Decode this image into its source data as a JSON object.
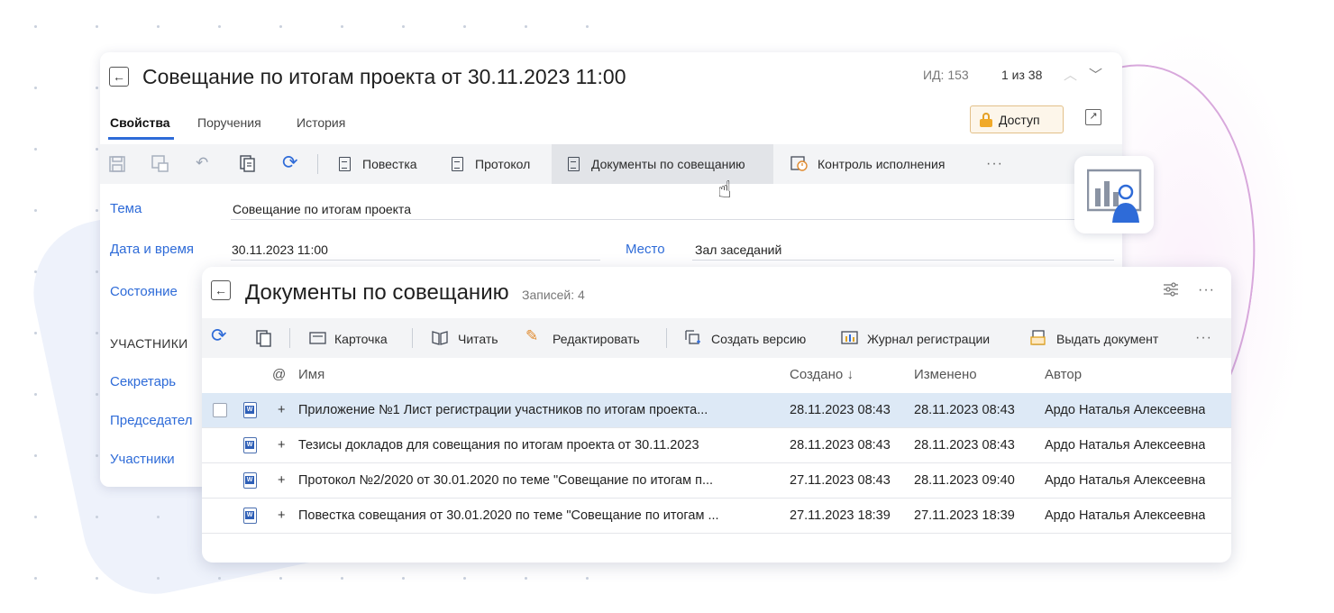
{
  "card": {
    "title": "Совещание по итогам проекта от 30.11.2023  11:00",
    "id_text": "ИД: 153",
    "nav_text": "1 из 38",
    "tabs": [
      "Свойства",
      "Поручения",
      "История"
    ],
    "access_label": "Доступ",
    "toolbar": {
      "agenda": "Повестка",
      "protocol": "Протокол",
      "documents": "Документы по совещанию",
      "control": "Контроль исполнения",
      "more": "···"
    },
    "fields": {
      "topic_label": "Тема",
      "topic_value": "Совещание по итогам проекта",
      "datetime_label": "Дата и время",
      "datetime_value": "30.11.2023  11:00",
      "place_label": "Место",
      "place_value": "Зал заседаний",
      "state_label": "Состояние",
      "participants_section": "УЧАСТНИКИ",
      "secretary_label": "Секретарь",
      "chairman_label": "Председател",
      "participants_label": "Участники"
    }
  },
  "documents": {
    "title": "Документы по совещанию",
    "count": "Записей: 4",
    "more": "···",
    "toolbar": {
      "card": "Карточка",
      "read": "Читать",
      "edit": "Редактировать",
      "new_version": "Создать версию",
      "journal": "Журнал регистрации",
      "issue": "Выдать документ",
      "more": "···"
    },
    "columns": {
      "at": "@",
      "name": "Имя",
      "created": "Создано ↓",
      "modified": "Изменено",
      "author": "Автор"
    },
    "rows": [
      {
        "plus": "+",
        "name": "Приложение №1 Лист регистрации участников по итогам проекта...",
        "created": "28.11.2023 08:43",
        "modified": "28.11.2023 08:43",
        "author": "Ардо Наталья Алексеевна"
      },
      {
        "plus": "+",
        "name": "Тезисы докладов для совещания по итогам проекта от 30.11.2023",
        "created": "28.11.2023 08:43",
        "modified": "28.11.2023 08:43",
        "author": "Ардо Наталья Алексеевна"
      },
      {
        "plus": "+",
        "name": "Протокол №2/2020 от 30.01.2020 по теме \"Совещание по итогам п...",
        "created": "27.11.2023 08:43",
        "modified": "28.11.2023 09:40",
        "author": "Ардо Наталья Алексеевна"
      },
      {
        "plus": "+",
        "name": "Повестка совещания от 30.01.2020 по теме \"Совещание по итогам ...",
        "created": "27.11.2023 18:39",
        "modified": "27.11.2023 18:39",
        "author": "Ардо Наталья Алексеевна"
      }
    ]
  },
  "icons": {
    "word": "W"
  },
  "colors": {
    "accent": "#2e6bd8",
    "selected_row": "#dde9f6",
    "access_bg": "#fdf6ea",
    "lock": "#f0a928"
  }
}
